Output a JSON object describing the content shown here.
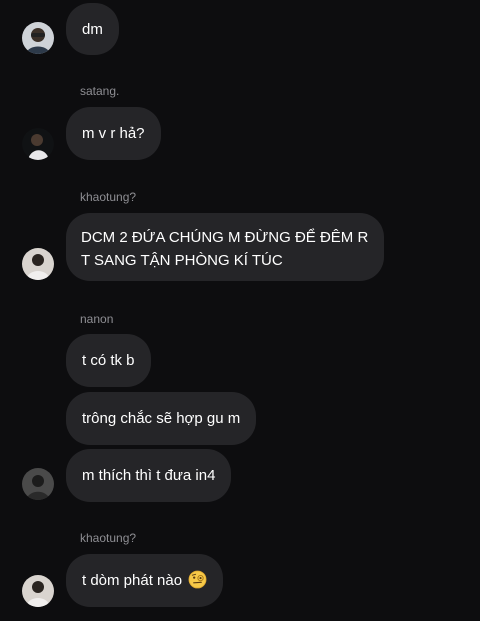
{
  "messages": [
    {
      "sender": "",
      "text": "dm"
    },
    {
      "sender": "satang.",
      "text": "m v r hả?"
    },
    {
      "sender": "khaotung?",
      "text": "DCM 2 ĐỨA CHÚNG M ĐỪNG ĐỂ ĐÊM R T SANG TẬN PHÒNG KÍ TÚC"
    },
    {
      "sender": "nanon",
      "text": "t có tk b"
    },
    {
      "sender": "",
      "text": "trông chắc sẽ hợp gu m"
    },
    {
      "sender": "",
      "text": "m thích thì t đưa in4"
    },
    {
      "sender": "khaotung?",
      "text": "t dòm phát nào"
    }
  ],
  "emoji": {
    "name": "face-with-monocle-emoji"
  }
}
